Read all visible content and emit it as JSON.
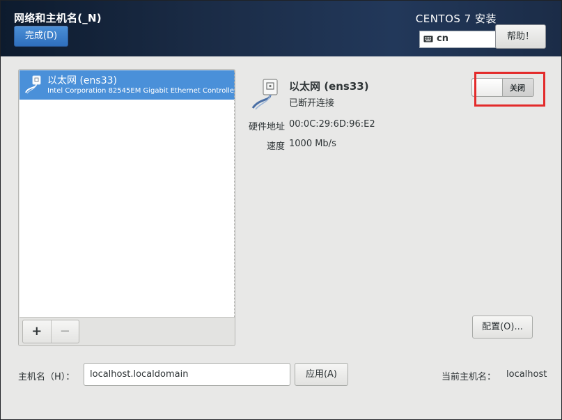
{
  "header": {
    "title": "网络和主机名(_N)",
    "done_label": "完成(D)",
    "product": "CENTOS 7 安装",
    "keyboard_layout": "cn",
    "help_label": "帮助！"
  },
  "device_list": {
    "items": [
      {
        "title": "以太网 (ens33)",
        "subtitle": "Intel Corporation 82545EM Gigabit Ethernet Controller (",
        "selected": true,
        "icon": "ethernet-cable-icon"
      }
    ],
    "add_label": "+",
    "remove_label": "−"
  },
  "details": {
    "icon": "ethernet-cable-icon",
    "name": "以太网 (ens33)",
    "status": "已断开连接",
    "hw_label": "硬件地址",
    "hw_value": "00:0C:29:6D:96:E2",
    "speed_label": "速度",
    "speed_value": "1000 Mb/s",
    "switch_label": "关闭",
    "switch_on": false,
    "configure_label": "配置(O)..."
  },
  "hostname": {
    "label": "主机名（H）：",
    "value": "localhost.localdomain",
    "apply_label": "应用(A)",
    "current_label": "当前主机名：",
    "current_value": "localhost"
  },
  "colors": {
    "header_bg": "#1a2b45",
    "accent": "#4a90d9",
    "highlight": "#e32b2b",
    "panel_bg": "#e8e8e7"
  }
}
